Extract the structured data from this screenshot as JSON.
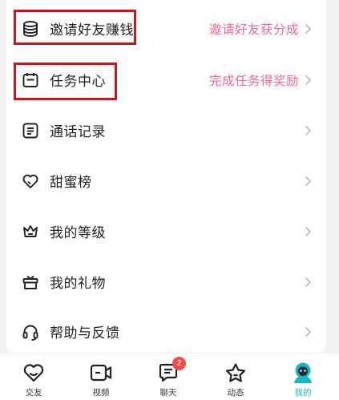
{
  "menu": {
    "items": [
      {
        "label": "邀请好友赚钱",
        "hint": "邀请好友获分成",
        "icon": "coin-stack-icon"
      },
      {
        "label": "任务中心",
        "hint": "完成任务得奖励",
        "icon": "calendar-icon"
      },
      {
        "label": "通话记录",
        "hint": "",
        "icon": "call-log-icon"
      },
      {
        "label": "甜蜜榜",
        "hint": "",
        "icon": "heart-icon"
      },
      {
        "label": "我的等级",
        "hint": "",
        "icon": "crown-icon"
      },
      {
        "label": "我的礼物",
        "hint": "",
        "icon": "gift-icon"
      },
      {
        "label": "帮助与反馈",
        "hint": "",
        "icon": "headset-icon"
      }
    ]
  },
  "tabbar": {
    "tabs": [
      {
        "label": "交友",
        "icon": "heart-icon"
      },
      {
        "label": "视频",
        "icon": "video-camera-icon"
      },
      {
        "label": "聊天",
        "icon": "chat-bubble-icon",
        "badge": "2"
      },
      {
        "label": "动态",
        "icon": "star-icon"
      },
      {
        "label": "我的",
        "icon": "avatar-icon",
        "active": true
      }
    ]
  },
  "colors": {
    "accent": "#18b8c8",
    "hint_text": "#e86a92",
    "highlight_box": "#c8161e",
    "badge": "#f24c4c"
  }
}
